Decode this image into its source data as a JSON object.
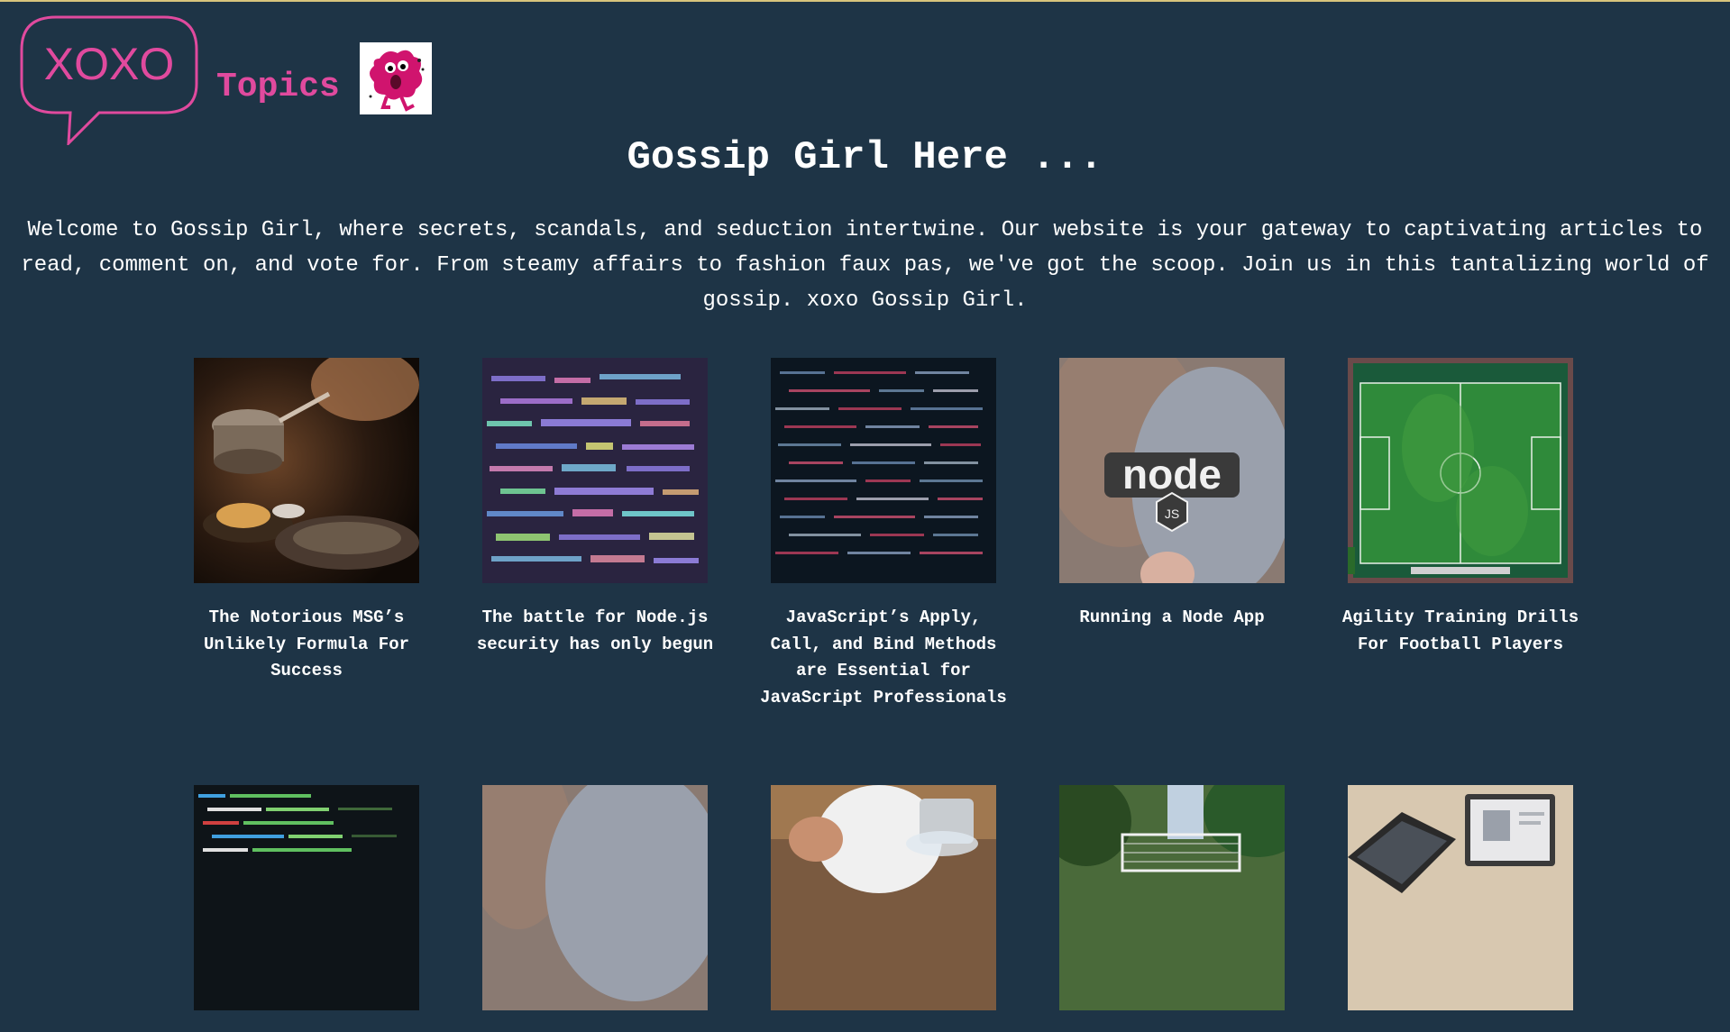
{
  "header": {
    "logo_text": "XOXO",
    "topics_label": "Topics"
  },
  "page": {
    "title": "Gossip Girl Here ...",
    "intro": "Welcome to Gossip Girl, where secrets, scandals, and seduction intertwine. Our website is your gateway to captivating articles to read, comment on, and vote for. From steamy affairs to fashion faux pas, we've got the scoop. Join us in this tantalizing world of gossip. xoxo Gossip Girl."
  },
  "articles": [
    {
      "title": "The Notorious MSG’s Unlikely Formula For Success",
      "thumb": "cooking-pan"
    },
    {
      "title": "The battle for Node.js security has only begun",
      "thumb": "code-screen-colorful"
    },
    {
      "title": "JavaScript’s Apply, Call, and Bind Methods are Essential for JavaScript Professionals",
      "thumb": "code-screen-dark"
    },
    {
      "title": "Running a Node App",
      "thumb": "nodejs-sticker"
    },
    {
      "title": "Agility Training Drills For Football Players",
      "thumb": "football-field"
    },
    {
      "title": "",
      "thumb": "code-terminal-green"
    },
    {
      "title": "",
      "thumb": "blurred-person"
    },
    {
      "title": "",
      "thumb": "chef-cooking"
    },
    {
      "title": "",
      "thumb": "football-goal"
    },
    {
      "title": "",
      "thumb": "laptops-desk"
    }
  ],
  "colors": {
    "background": "#1e3446",
    "accent_pink": "#e04a9e",
    "text": "#ffffff"
  }
}
